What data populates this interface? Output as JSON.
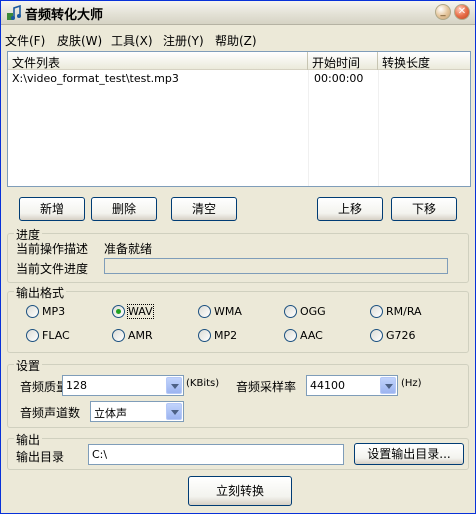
{
  "window": {
    "title": "音频转化大师"
  },
  "titlebar_buttons": {
    "minimize": "_",
    "maximize": "□",
    "close": "✕"
  },
  "menu": [
    "文件(F)",
    "皮肤(W)",
    "工具(X)",
    "注册(Y)",
    "帮助(Z)"
  ],
  "list": {
    "columns": [
      "文件列表",
      "开始时间",
      "转换长度"
    ],
    "rows": [
      {
        "file": "X:\\video_format_test\\test.mp3",
        "start": "00:00:00",
        "length": ""
      }
    ]
  },
  "list_buttons": {
    "add": "新增",
    "delete": "删除",
    "clear": "清空",
    "up": "上移",
    "down": "下移"
  },
  "progress": {
    "title": "进度",
    "current_op_label": "当前操作描述",
    "current_op_value": "准备就绪",
    "file_progress_label": "当前文件进度",
    "file_progress_value": 0
  },
  "output_format": {
    "title": "输出格式",
    "options": [
      "MP3",
      "WAV",
      "WMA",
      "OGG",
      "RM/RA",
      "FLAC",
      "AMR",
      "MP2",
      "AAC",
      "G726"
    ],
    "selected": "WAV"
  },
  "settings": {
    "title": "设置",
    "quality_label": "音频质量",
    "quality_value": "128",
    "quality_unit": "(KBits)",
    "samplerate_label": "音频采样率",
    "samplerate_value": "44100",
    "samplerate_unit": "(Hz)",
    "channels_label": "音频声道数",
    "channels_value": "立体声"
  },
  "output": {
    "title": "输出",
    "dir_label": "输出目录",
    "dir_value": "C:\\",
    "set_dir_button": "设置输出目录..."
  },
  "convert_button": "立刻转换"
}
